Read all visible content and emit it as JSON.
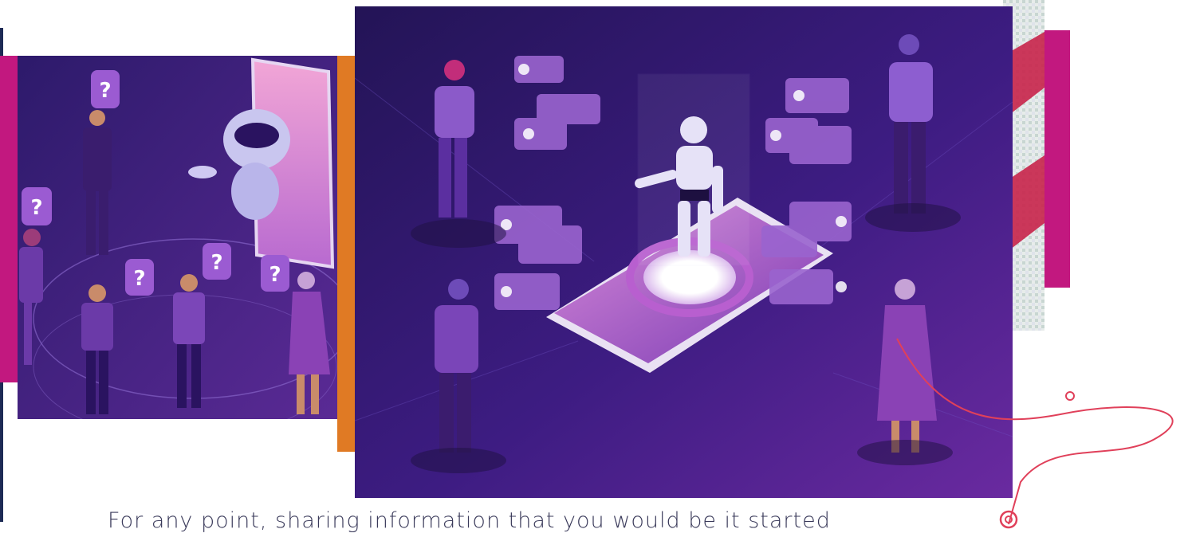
{
  "caption": {
    "text": "For any point, sharing information that you would be it started"
  },
  "illustrations": [
    {
      "name": "chatbot-question-illustration"
    },
    {
      "name": "robot-smartphone-chat-illustration"
    }
  ],
  "colors": {
    "magenta": "#c2187f",
    "orange": "#e07a24",
    "navy": "#1d2a55",
    "purple_dark": "#2a1360",
    "purple_mid": "#5d2b9b",
    "red_line": "#e0405a"
  }
}
